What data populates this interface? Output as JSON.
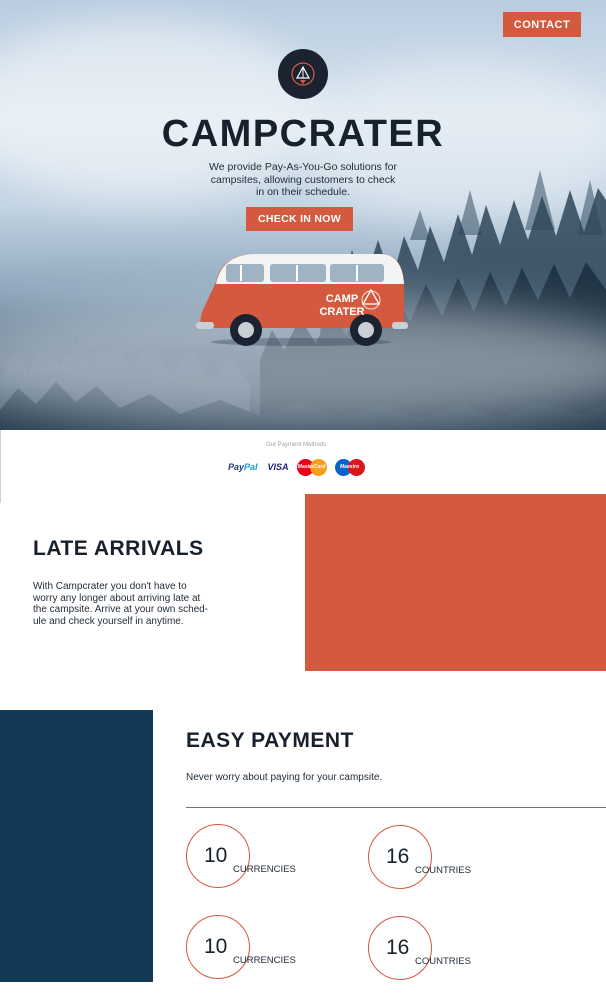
{
  "header": {
    "contact_label": "CONTACT"
  },
  "hero": {
    "title": "CAMPCRATER",
    "tagline_lines": [
      "We provide Pay-As-You-Go solutions for",
      "campsites, allowing customers to check",
      "in on their schedule."
    ],
    "cta_label": "CHECK IN NOW",
    "van_brand_line1": "CAMP",
    "van_brand_line2": "CRATER"
  },
  "payments": {
    "label": "Our Payment Methods",
    "paypal_a": "Pay",
    "paypal_b": "Pal",
    "visa": "VISA",
    "mastercard": "MasterCard",
    "maestro": "Maestro"
  },
  "late_arrivals": {
    "title": "LATE ARRIVALS",
    "text_lines": [
      "With Campcrater you don't have to",
      "worry any longer about arriving late at",
      "the campsite. Arrive at your own sched-",
      "ule and check yourself in anytime."
    ]
  },
  "easy_payment": {
    "title": "EASY PAYMENT",
    "text": "Never worry about paying for your campsite.",
    "stats": [
      {
        "value": "10",
        "unit": "CURRENCIES"
      },
      {
        "value": "16",
        "unit": "COUNTRIES"
      },
      {
        "value": "10",
        "unit": "CURRENCIES"
      },
      {
        "value": "16",
        "unit": "COUNTRIES"
      }
    ]
  },
  "colors": {
    "accent": "#d35a3e",
    "navy": "#123a57",
    "dark_text": "#17212b"
  }
}
